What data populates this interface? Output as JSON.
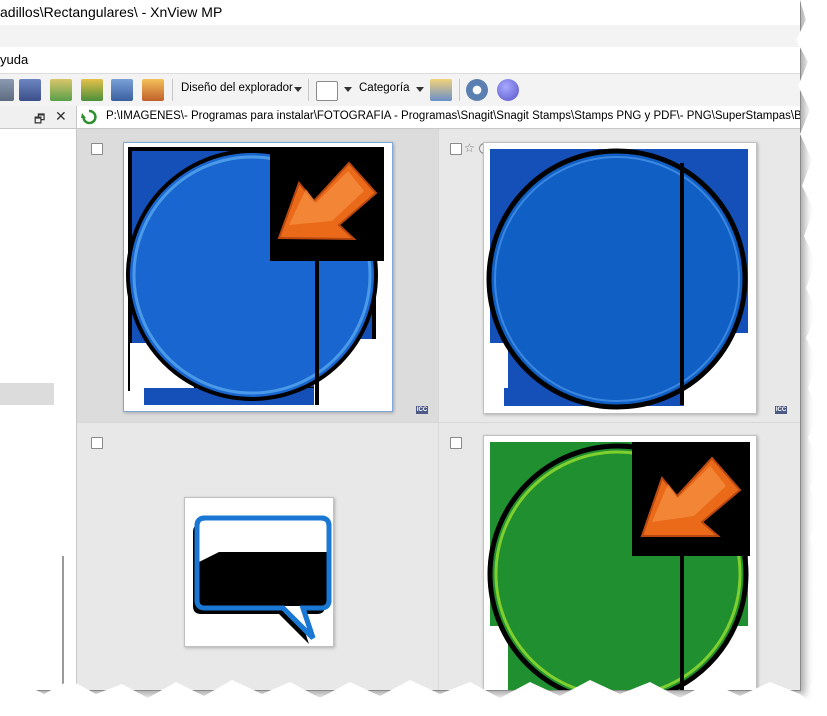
{
  "window": {
    "title": "adillos\\Rectangulares\\ - XnView MP"
  },
  "menu": {
    "items": [
      "yuda"
    ]
  },
  "toolbar": {
    "layout_label": "Diseño del explorador",
    "category_label": "Categoría",
    "colors": {
      "blue": "#3a6fc4",
      "orange": "#e8832a",
      "gear": "#5a7fb0",
      "help": "#6f6fcf"
    }
  },
  "path": {
    "value": "P:\\IMAGENES\\- Programas para instalar\\FOTOGRAFIA - Programas\\Snagit\\Snagit Stamps\\Stamps PNG y PDF\\- PNG\\SuperStampas\\Bocadillos\\R"
  },
  "thumbnails": [
    {
      "badge": "ICC",
      "selected": true,
      "color": "#0f5fc4"
    },
    {
      "badge": "ICC",
      "selected": false,
      "color": "#0f5fc4"
    },
    {
      "badge": "",
      "selected": false,
      "color": "#1a78d4"
    },
    {
      "badge": "",
      "selected": false,
      "color": "#1f8f2f"
    }
  ]
}
